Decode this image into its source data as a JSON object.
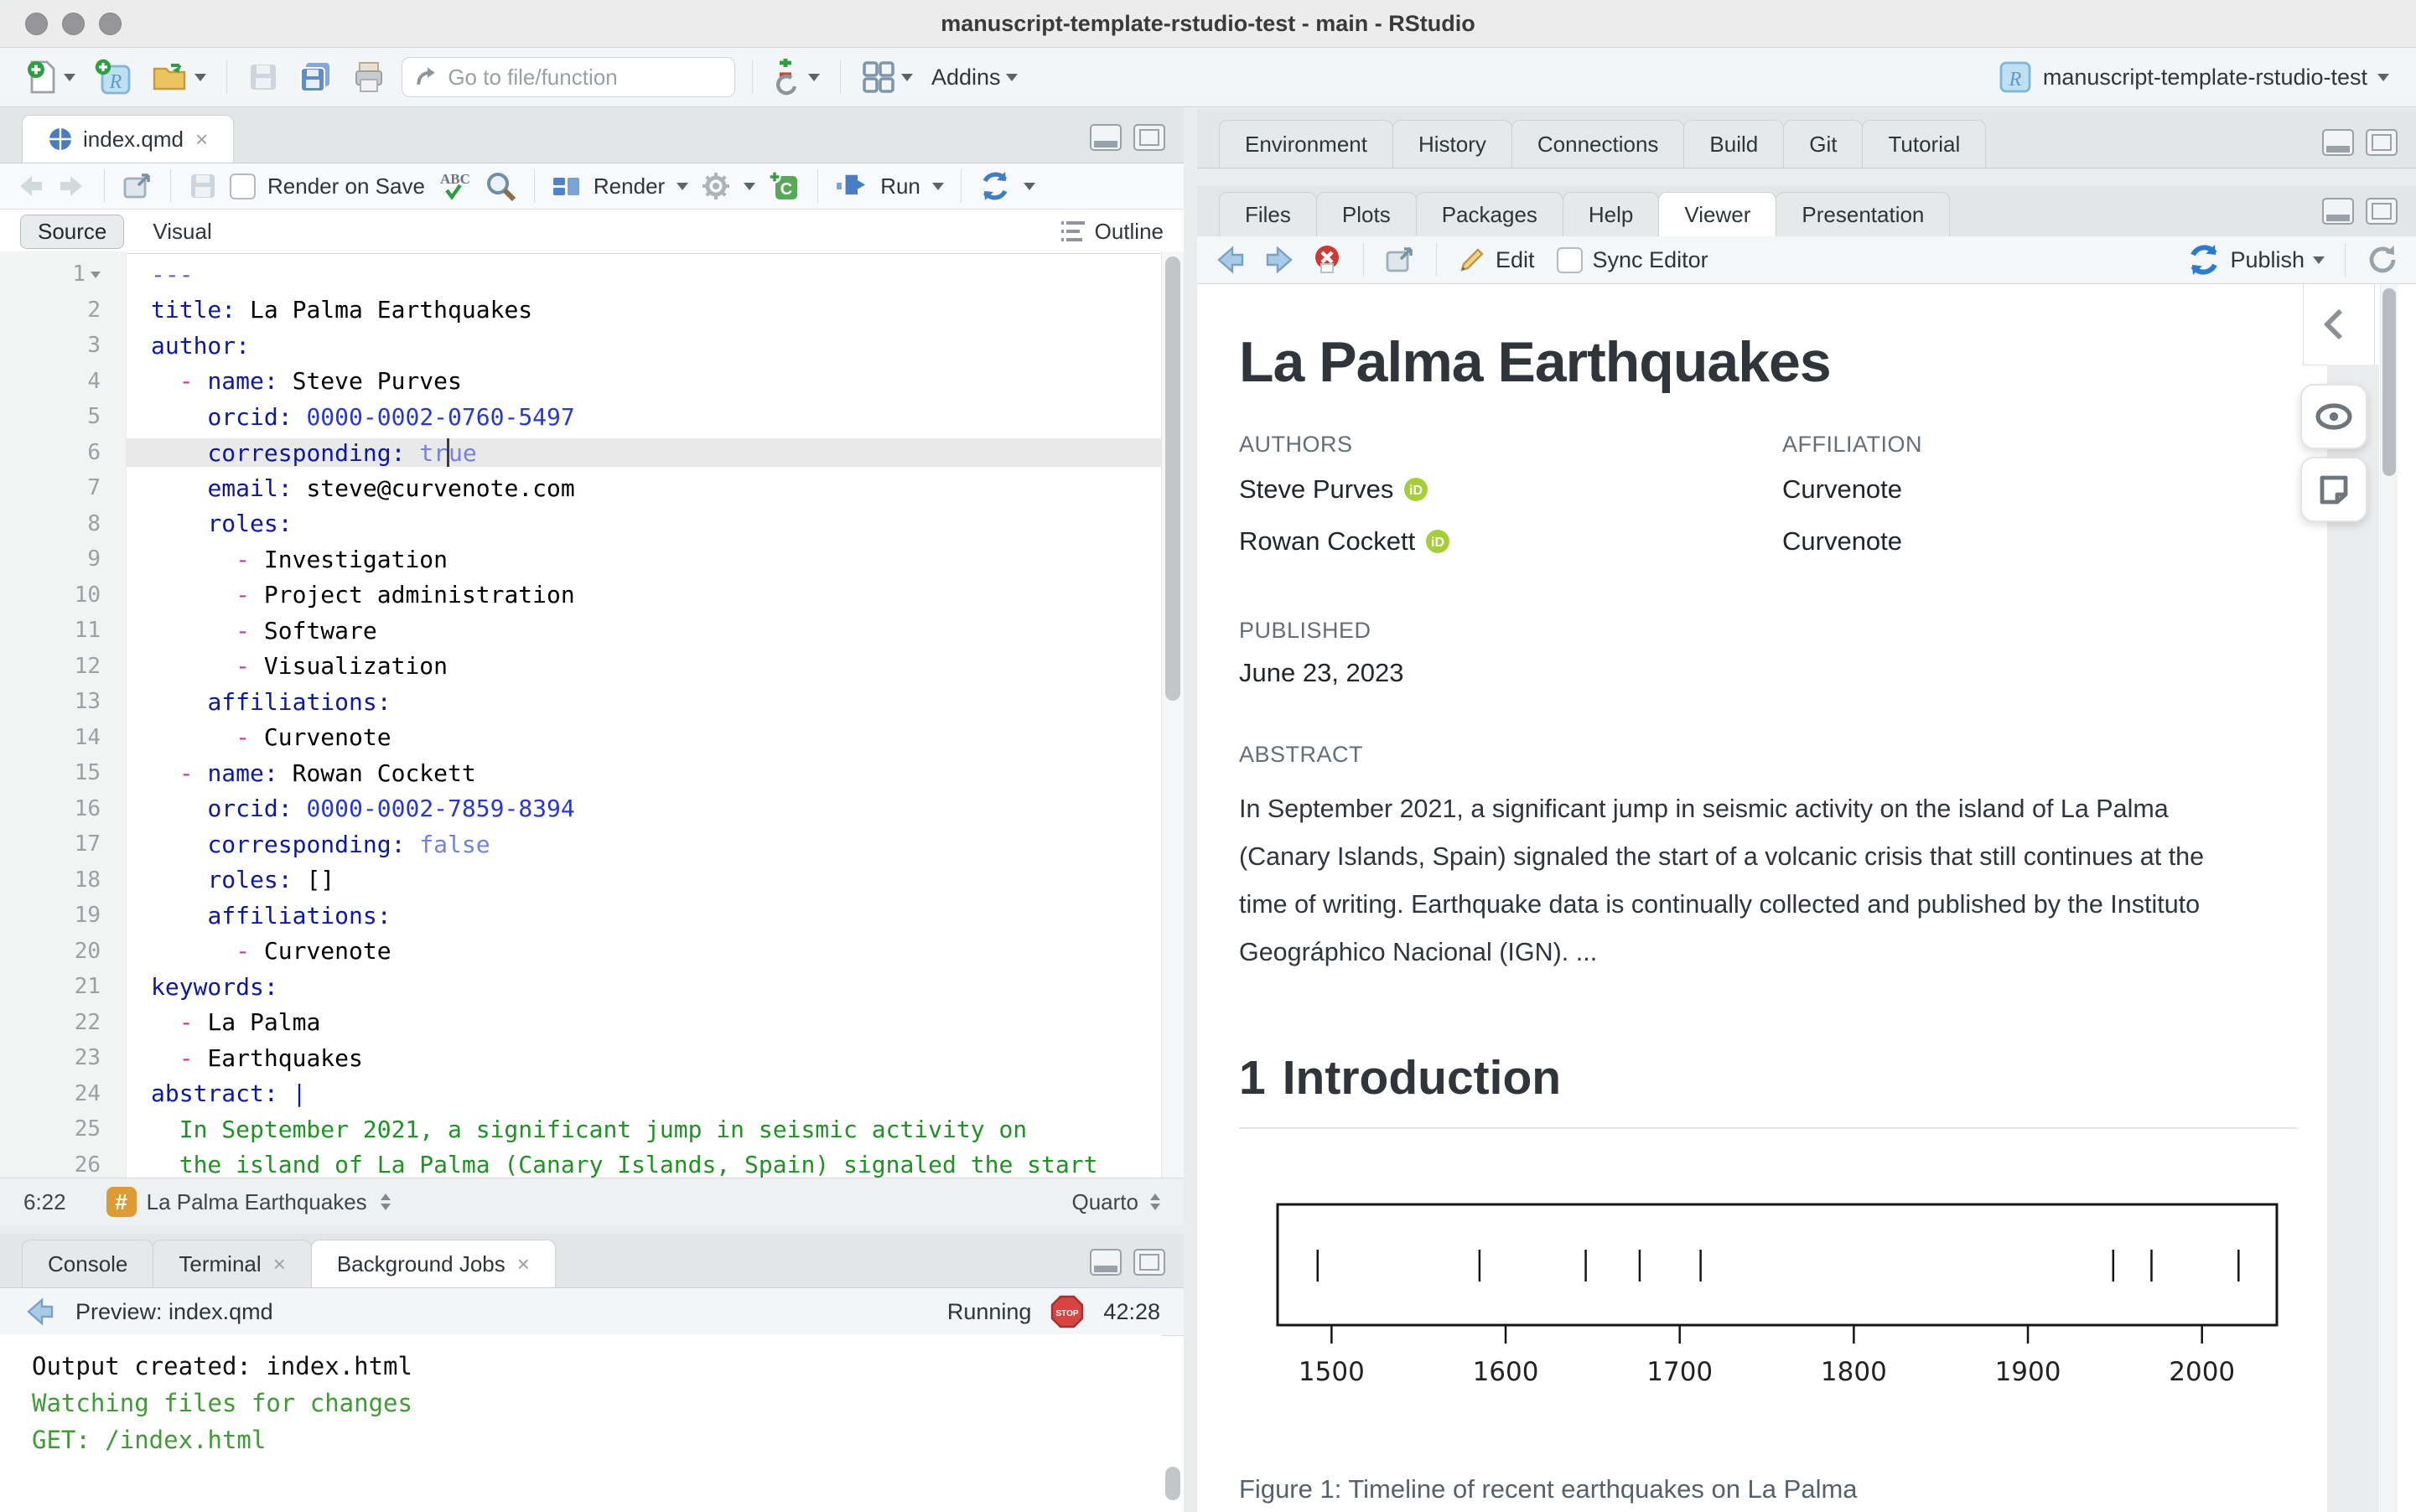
{
  "window": {
    "title": "manuscript-template-rstudio-test - main - RStudio"
  },
  "toolbar": {
    "goto_placeholder": "Go to file/function",
    "addins_label": "Addins",
    "project_name": "manuscript-template-rstudio-test"
  },
  "editor": {
    "tab": "index.qmd",
    "render_on_save": "Render on Save",
    "render_label": "Render",
    "run_label": "Run",
    "source_label": "Source",
    "visual_label": "Visual",
    "outline_label": "Outline",
    "status": {
      "position": "6:22",
      "section": "La Palma Earthquakes",
      "mode": "Quarto"
    },
    "lines": [
      {
        "n": 1,
        "fold": true,
        "segs": [
          [
            "---",
            "meta"
          ]
        ]
      },
      {
        "n": 2,
        "segs": [
          [
            "title:",
            "key"
          ],
          [
            " La Palma Earthquakes",
            "val"
          ]
        ]
      },
      {
        "n": 3,
        "segs": [
          [
            "author:",
            "key"
          ]
        ]
      },
      {
        "n": 4,
        "segs": [
          [
            "  ",
            "val"
          ],
          [
            "- ",
            "dash"
          ],
          [
            "name:",
            "key"
          ],
          [
            " Steve Purves",
            "val"
          ]
        ]
      },
      {
        "n": 5,
        "segs": [
          [
            "    ",
            "val"
          ],
          [
            "orcid:",
            "key"
          ],
          [
            " ",
            "val"
          ],
          [
            "0000-0002-0760-5497",
            "num"
          ]
        ]
      },
      {
        "n": 6,
        "hl": true,
        "segs": [
          [
            "    ",
            "val"
          ],
          [
            "corresponding:",
            "key"
          ],
          [
            " ",
            "val"
          ],
          [
            "tr",
            "bool"
          ],
          [
            "",
            "caret"
          ],
          [
            "ue",
            "bool"
          ]
        ]
      },
      {
        "n": 7,
        "segs": [
          [
            "    ",
            "val"
          ],
          [
            "email:",
            "key"
          ],
          [
            " steve@curvenote.com",
            "val"
          ]
        ]
      },
      {
        "n": 8,
        "segs": [
          [
            "    ",
            "val"
          ],
          [
            "roles:",
            "key"
          ]
        ]
      },
      {
        "n": 9,
        "segs": [
          [
            "      ",
            "val"
          ],
          [
            "- ",
            "dash"
          ],
          [
            "Investigation",
            "val"
          ]
        ]
      },
      {
        "n": 10,
        "segs": [
          [
            "      ",
            "val"
          ],
          [
            "- ",
            "dash"
          ],
          [
            "Project administration",
            "val"
          ]
        ]
      },
      {
        "n": 11,
        "segs": [
          [
            "      ",
            "val"
          ],
          [
            "- ",
            "dash"
          ],
          [
            "Software",
            "val"
          ]
        ]
      },
      {
        "n": 12,
        "segs": [
          [
            "      ",
            "val"
          ],
          [
            "- ",
            "dash"
          ],
          [
            "Visualization",
            "val"
          ]
        ]
      },
      {
        "n": 13,
        "segs": [
          [
            "    ",
            "val"
          ],
          [
            "affiliations:",
            "key"
          ]
        ]
      },
      {
        "n": 14,
        "segs": [
          [
            "      ",
            "val"
          ],
          [
            "- ",
            "dash"
          ],
          [
            "Curvenote",
            "val"
          ]
        ]
      },
      {
        "n": 15,
        "segs": [
          [
            "  ",
            "val"
          ],
          [
            "- ",
            "dash"
          ],
          [
            "name:",
            "key"
          ],
          [
            " Rowan Cockett",
            "val"
          ]
        ]
      },
      {
        "n": 16,
        "segs": [
          [
            "    ",
            "val"
          ],
          [
            "orcid:",
            "key"
          ],
          [
            " ",
            "val"
          ],
          [
            "0000-0002-7859-8394",
            "num"
          ]
        ]
      },
      {
        "n": 17,
        "segs": [
          [
            "    ",
            "val"
          ],
          [
            "corresponding:",
            "key"
          ],
          [
            " ",
            "val"
          ],
          [
            "false",
            "bool"
          ]
        ]
      },
      {
        "n": 18,
        "segs": [
          [
            "    ",
            "val"
          ],
          [
            "roles:",
            "key"
          ],
          [
            " []",
            "val"
          ]
        ]
      },
      {
        "n": 19,
        "segs": [
          [
            "    ",
            "val"
          ],
          [
            "affiliations:",
            "key"
          ]
        ]
      },
      {
        "n": 20,
        "segs": [
          [
            "      ",
            "val"
          ],
          [
            "- ",
            "dash"
          ],
          [
            "Curvenote",
            "val"
          ]
        ]
      },
      {
        "n": 21,
        "segs": [
          [
            "keywords:",
            "key"
          ]
        ]
      },
      {
        "n": 22,
        "segs": [
          [
            "  ",
            "val"
          ],
          [
            "- ",
            "dash"
          ],
          [
            "La Palma",
            "val"
          ]
        ]
      },
      {
        "n": 23,
        "segs": [
          [
            "  ",
            "val"
          ],
          [
            "- ",
            "dash"
          ],
          [
            "Earthquakes",
            "val"
          ]
        ]
      },
      {
        "n": 24,
        "segs": [
          [
            "abstract:",
            "key"
          ],
          [
            " |",
            "key"
          ]
        ]
      },
      {
        "n": 25,
        "segs": [
          [
            "  In September 2021, a significant jump in seismic activity on",
            "str"
          ]
        ]
      },
      {
        "n": 26,
        "segs": [
          [
            "  the island of La Palma (Canary Islands, Spain) signaled the start",
            "str"
          ]
        ]
      }
    ]
  },
  "console": {
    "tabs_cfg": {
      "items": [
        {
          "label": "Console",
          "active": false,
          "closable": false
        },
        {
          "label": "Terminal",
          "active": false,
          "closable": true
        },
        {
          "label": "Background Jobs",
          "active": true,
          "closable": true
        }
      ]
    },
    "preview_label": "Preview: index.qmd",
    "running_label": "Running",
    "elapsed": "42:28",
    "output": [
      {
        "text": "Output created: index.html",
        "cls": "plain"
      },
      {
        "text": " ",
        "cls": "plain"
      },
      {
        "text": "Watching files for changes",
        "cls": "green"
      },
      {
        "text": "GET: /index.html",
        "cls": "green"
      }
    ]
  },
  "right": {
    "env_tabs": {
      "items": [
        {
          "label": "Environment",
          "active": false,
          "closable": false
        },
        {
          "label": "History",
          "active": false,
          "closable": false
        },
        {
          "label": "Connections",
          "active": false,
          "closable": false
        },
        {
          "label": "Build",
          "active": false,
          "closable": false
        },
        {
          "label": "Git",
          "active": false,
          "closable": false
        },
        {
          "label": "Tutorial",
          "active": false,
          "closable": false
        }
      ]
    },
    "files_tabs": {
      "items": [
        {
          "label": "Files",
          "active": false,
          "closable": false
        },
        {
          "label": "Plots",
          "active": false,
          "closable": false
        },
        {
          "label": "Packages",
          "active": false,
          "closable": false
        },
        {
          "label": "Help",
          "active": false,
          "closable": false
        },
        {
          "label": "Viewer",
          "active": true,
          "closable": false
        },
        {
          "label": "Presentation",
          "active": false,
          "closable": false
        }
      ]
    },
    "viewer_toolbar": {
      "edit": "Edit",
      "sync": "Sync Editor",
      "publish": "Publish"
    }
  },
  "document": {
    "title": "La Palma Earthquakes",
    "authors_label": "AUTHORS",
    "affiliation_label": "AFFILIATION",
    "authors": [
      {
        "name": "Steve Purves",
        "affiliation": "Curvenote"
      },
      {
        "name": "Rowan Cockett",
        "affiliation": "Curvenote"
      }
    ],
    "published_label": "PUBLISHED",
    "published_date": "June 23, 2023",
    "abstract_label": "ABSTRACT",
    "abstract": "In September 2021, a significant jump in seismic activity on the island of La Palma (Canary Islands, Spain) signaled the start of a volcanic crisis that still continues at the time of writing. Earthquake data is continually collected and published by the Instituto Geográphico Nacional (IGN). ...",
    "section_number": "1",
    "section_title": "Introduction",
    "figure_caption": "Figure 1: Timeline of recent earthquakes on La Palma"
  },
  "chart_data": {
    "type": "rug",
    "title": "Timeline of recent earthquakes on La Palma",
    "eruption_years": [
      1492,
      1585,
      1646,
      1677,
      1712,
      1949,
      1971,
      2021
    ],
    "x_ticks": [
      1500,
      1600,
      1700,
      1800,
      1900,
      2000
    ],
    "xlim": [
      1469,
      2043
    ],
    "xlabel": "",
    "ylabel": "",
    "grid": false
  },
  "colors": {
    "accent_blue": "#4a7ec2",
    "publish_blue": "#2e7ad1",
    "run_blue": "#4a7ec2",
    "console_green": "#3f9b35",
    "yaml_key": "#0c17a8",
    "yaml_bool": "#7481e0",
    "yaml_dash": "#cd3a9d",
    "yaml_string": "#1d9422",
    "orcid_green": "#A6CE39",
    "chip_orange": "#dd9b33",
    "stop_red": "#d64541"
  }
}
